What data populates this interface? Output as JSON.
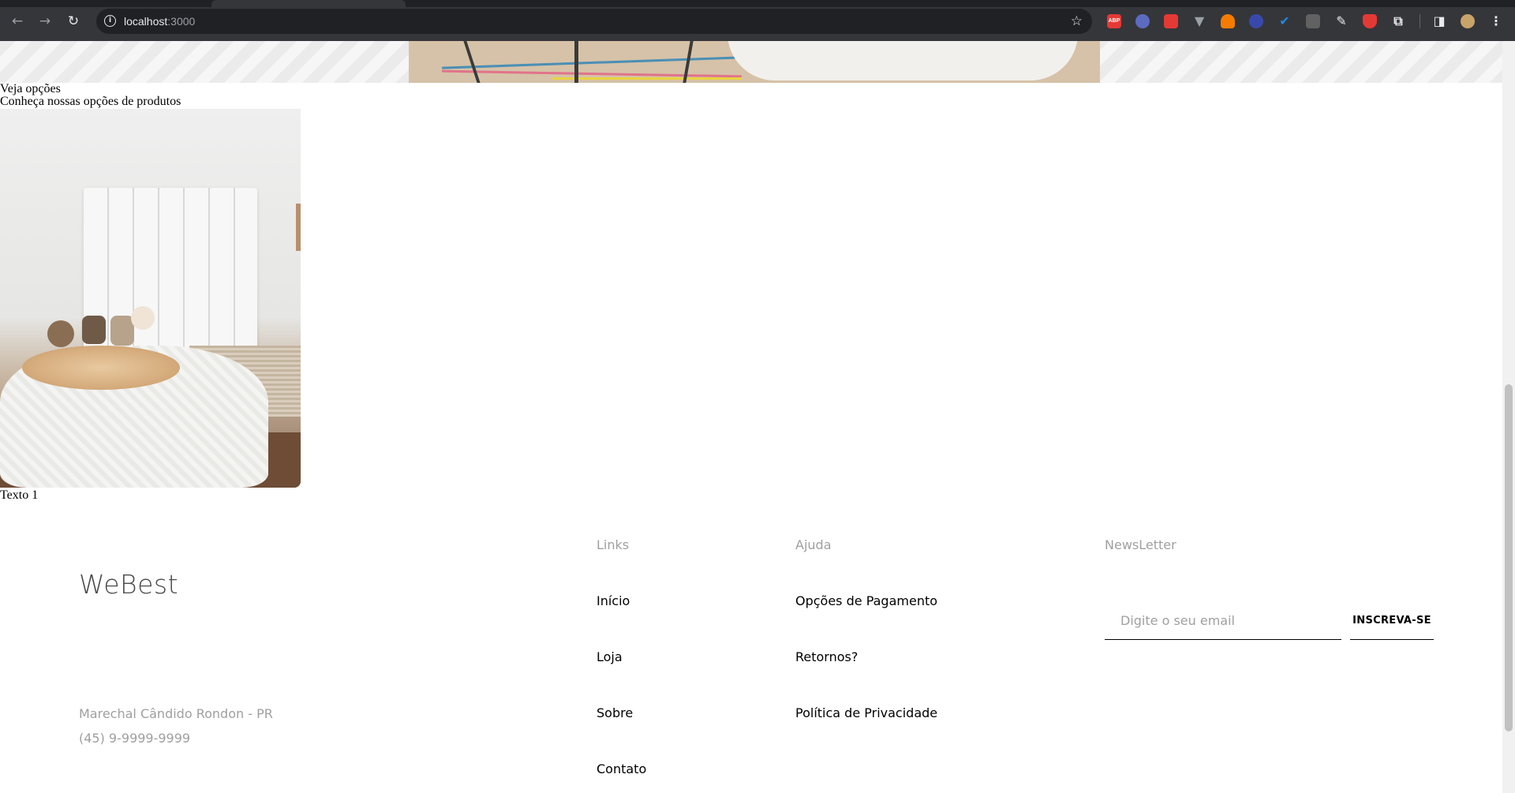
{
  "browser": {
    "url_host": "localhost",
    "url_port": ":3000",
    "extensions": [
      {
        "icon": "adblock-plus-icon",
        "label": "ABP",
        "color": "#e53935"
      },
      {
        "icon": "cursor-extension-icon",
        "label": "",
        "color": "#5c6bc0"
      },
      {
        "icon": "red-puzzle-extension-icon",
        "label": "",
        "color": "#e53935"
      },
      {
        "icon": "vue-devtools-icon",
        "label": "",
        "color": "#9aa0a6"
      },
      {
        "icon": "orange-extension-icon",
        "label": "",
        "color": "#f57c00"
      },
      {
        "icon": "eye-extension-icon",
        "label": "",
        "color": "#3949ab"
      },
      {
        "icon": "checkmark-extension-icon",
        "label": "",
        "color": "#1e88e5"
      },
      {
        "icon": "glasses-extension-icon",
        "label": "",
        "color": "#616161"
      },
      {
        "icon": "eyedropper-extension-icon",
        "label": "",
        "color": "#e8eaed"
      },
      {
        "icon": "shield-extension-icon",
        "label": "",
        "color": "#e53935"
      }
    ]
  },
  "page": {
    "section_title": "Veja opções",
    "section_subtitle": "Conheça nossas opções de produtos",
    "product_caption": "Texto 1"
  },
  "footer": {
    "brand": "WeBest",
    "location": "Marechal Cândido Rondon - PR",
    "phone": "(45) 9-9999-9999",
    "links_heading": "Links",
    "links": [
      "Início",
      "Loja",
      "Sobre",
      "Contato"
    ],
    "help_heading": "Ajuda",
    "help_links": [
      "Opções de Pagamento",
      "Retornos?",
      "Política de Privacidade"
    ],
    "newsletter_heading": "NewsLetter",
    "newsletter_placeholder": "Digite o seu email",
    "subscribe_label": "INSCREVA-SE"
  }
}
